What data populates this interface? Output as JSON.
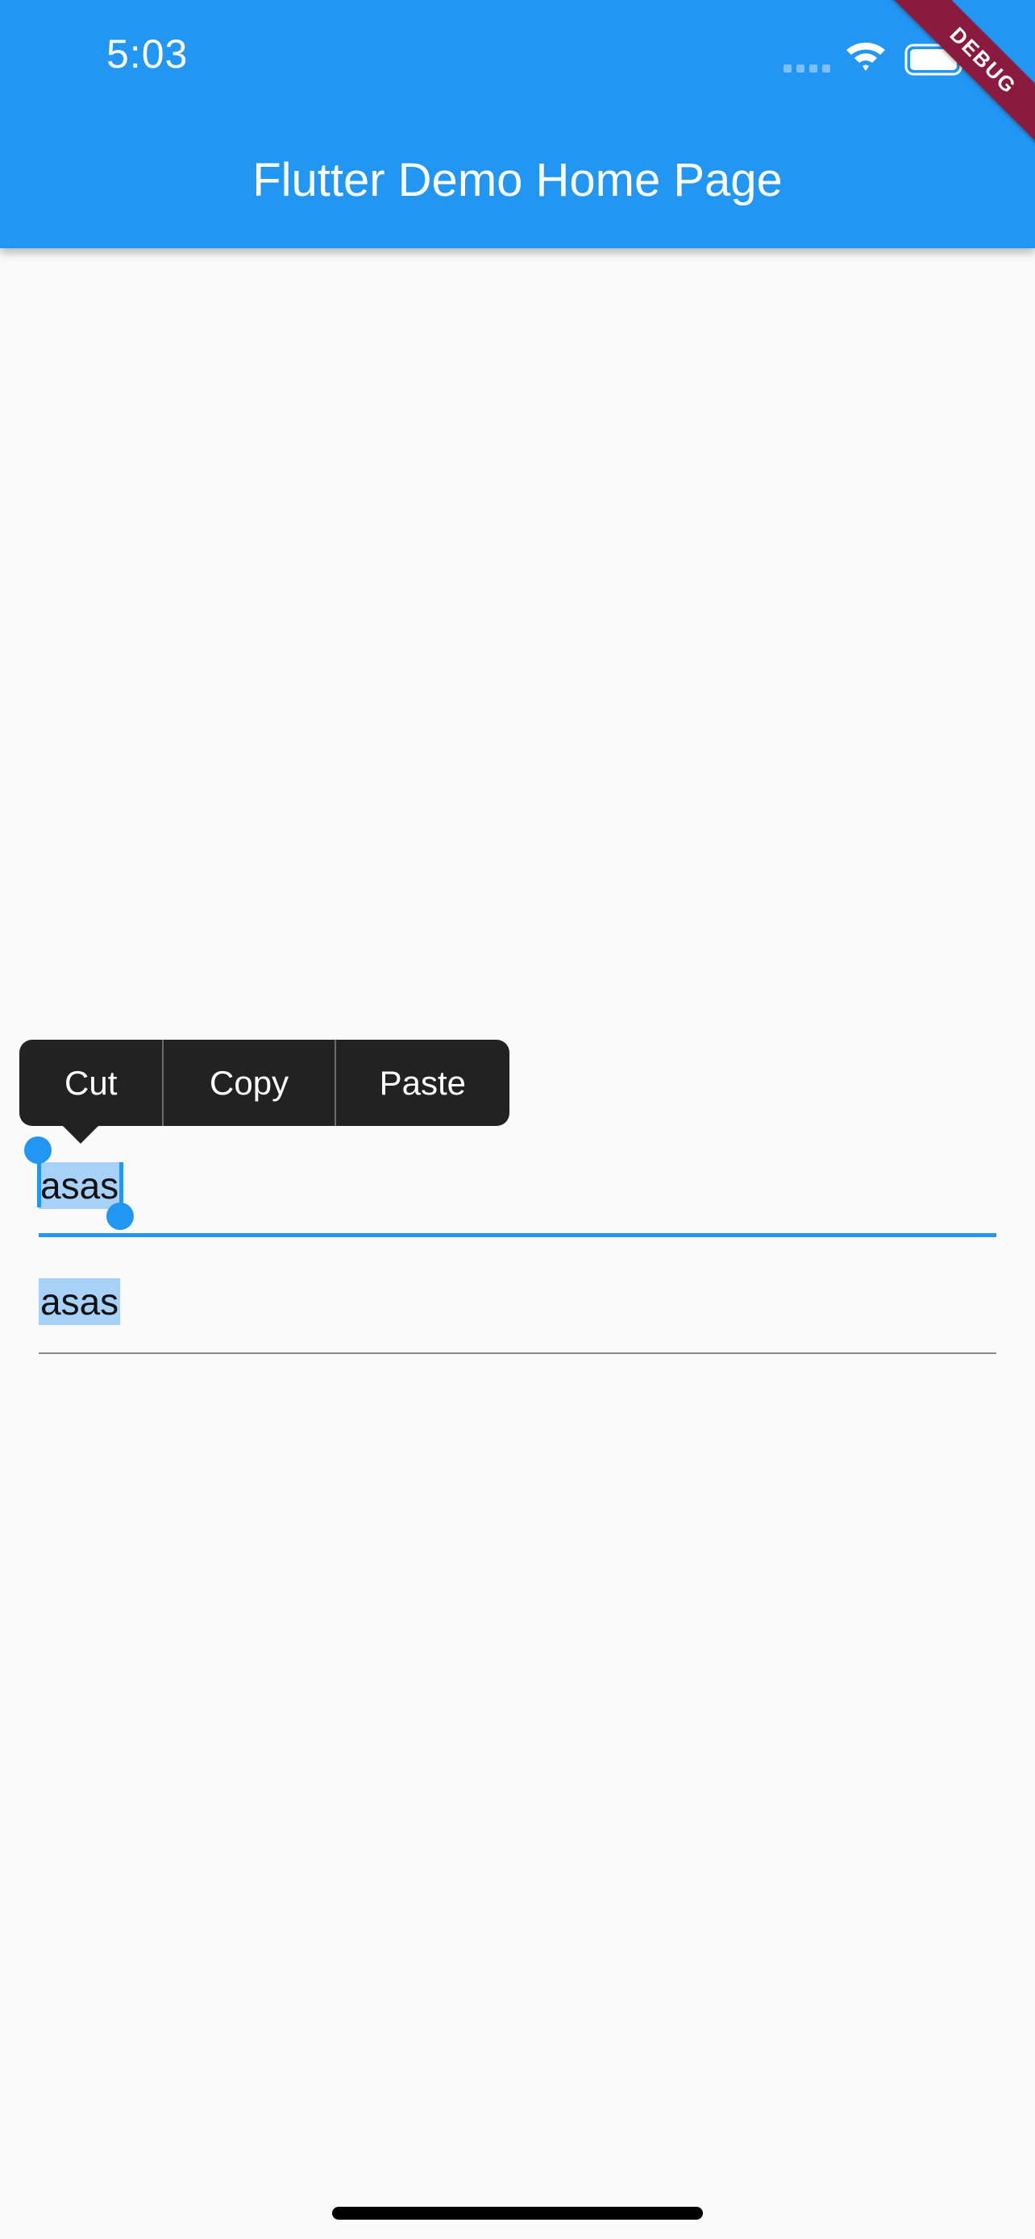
{
  "status_bar": {
    "time": "5:03",
    "icons": [
      "signal-icon",
      "wifi-icon",
      "battery-icon"
    ]
  },
  "app_bar": {
    "title": "Flutter Demo Home Page",
    "color": "#2196f3"
  },
  "debug_banner": {
    "label": "DEBUG",
    "color": "#8a1b3f"
  },
  "context_menu": {
    "cut_label": "Cut",
    "copy_label": "Copy",
    "paste_label": "Paste"
  },
  "fields": {
    "first_value": "asas",
    "second_value": "asas"
  }
}
